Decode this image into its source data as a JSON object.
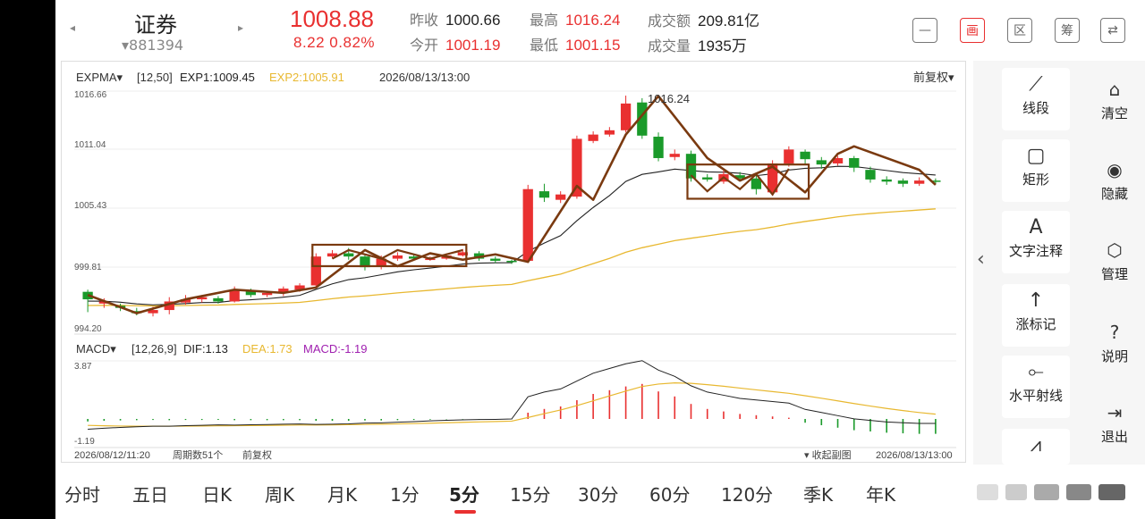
{
  "quote": {
    "nav_prev": "◂",
    "nav_next": "▸",
    "name": "证券",
    "code": "▾881394",
    "price": "1008.88",
    "change": "8.22  0.82%",
    "prev_close_label": "昨收",
    "prev_close": "1000.66",
    "open_label": "今开",
    "open": "1001.19",
    "high_label": "最高",
    "high": "1016.24",
    "low_label": "最低",
    "low": "1001.15",
    "amount_label": "成交额",
    "amount": "209.81亿",
    "volume_label": "成交量",
    "volume": "1935万"
  },
  "toolbar_buttons": [
    "—",
    "画",
    "区",
    "筹",
    "⇄"
  ],
  "chart": {
    "indicator": "EXPMA▾",
    "params": "[12,50]",
    "exp1": "EXP1:1009.45",
    "exp2": "EXP2:1005.91",
    "timestamp": "2026/08/13/13:00",
    "adjust": "前复权▾",
    "yticks": [
      "1016.66",
      "1011.04",
      "1005.43",
      "999.81",
      "994.20"
    ],
    "high_note": "1016.24",
    "macd_label": "MACD▾",
    "macd_params": "[12,26,9]",
    "dif": "DIF:1.13",
    "dea": "DEA:1.73",
    "macd": "MACD:-1.19",
    "macd_top": "3.87",
    "macd_bottom": "-1.19",
    "footer_start": "2026/08/12/11:20",
    "footer_count": "周期数51个",
    "footer_adjust": "前复权",
    "footer_collapse": "▾ 收起副图",
    "footer_end": "2026/08/13/13:00",
    "colors": {
      "up": "#e93030",
      "down": "#1a9a2a",
      "exp1": "#222222",
      "exp2": "#e8b830",
      "drawing": "#7a3a10"
    }
  },
  "tools": [
    "线段",
    "矩形",
    "文字注释",
    "涨标记",
    "水平射线"
  ],
  "tool_icons": [
    "segment-icon",
    "rectangle-icon",
    "text-annotation-icon",
    "up-mark-icon",
    "horizontal-ray-icon"
  ],
  "side_actions": [
    "清空",
    "隐藏",
    "管理",
    "说明",
    "退出"
  ],
  "periods": [
    "分时",
    "五日",
    "日K",
    "周K",
    "月K",
    "1分",
    "5分",
    "15分",
    "30分",
    "60分",
    "120分",
    "季K",
    "年K"
  ],
  "active_period": "5分",
  "candles": [
    [
      997.9,
      997.2,
      998.1,
      996.0
    ],
    [
      996.8,
      997.0,
      997.3,
      996.4
    ],
    [
      996.6,
      996.4,
      996.8,
      996.1
    ],
    [
      996.1,
      995.9,
      996.4,
      995.7
    ],
    [
      995.9,
      996.2,
      996.5,
      995.6
    ],
    [
      996.2,
      997.0,
      997.4,
      995.8
    ],
    [
      996.9,
      997.2,
      997.6,
      996.7
    ],
    [
      997.2,
      997.4,
      997.6,
      996.9
    ],
    [
      997.3,
      997.0,
      997.5,
      996.8
    ],
    [
      997.0,
      998.0,
      998.4,
      996.9
    ],
    [
      998.0,
      997.6,
      998.2,
      997.4
    ],
    [
      997.6,
      997.8,
      998.0,
      997.4
    ],
    [
      997.8,
      998.2,
      998.4,
      997.5
    ],
    [
      998.1,
      998.5,
      998.7,
      997.9
    ],
    [
      998.5,
      1001.2,
      1001.5,
      998.3
    ],
    [
      1001.2,
      1001.5,
      1001.8,
      1001.0
    ],
    [
      1001.5,
      1001.2,
      1002.0,
      1000.9
    ],
    [
      1001.2,
      1000.2,
      1001.4,
      999.9
    ],
    [
      1000.3,
      1001.0,
      1001.3,
      1000.0
    ],
    [
      1001.0,
      1001.3,
      1001.6,
      1000.8
    ],
    [
      1001.2,
      1001.0,
      1001.4,
      1000.9
    ],
    [
      1000.9,
      1001.0,
      1001.2,
      1000.8
    ],
    [
      1001.0,
      1001.3,
      1001.5,
      1000.9
    ],
    [
      1001.3,
      1001.6,
      1001.9,
      1001.2
    ],
    [
      1001.5,
      1001.0,
      1001.7,
      1000.8
    ],
    [
      1001.0,
      1000.8,
      1001.2,
      1000.6
    ],
    [
      1000.8,
      1000.7,
      1000.9,
      1000.5
    ],
    [
      1000.8,
      1007.5,
      1007.9,
      1000.6
    ],
    [
      1007.3,
      1006.7,
      1008.0,
      1006.3
    ],
    [
      1006.5,
      1007.0,
      1007.3,
      1006.2
    ],
    [
      1006.8,
      1012.2,
      1012.5,
      1006.6
    ],
    [
      1012.0,
      1012.6,
      1012.9,
      1011.8
    ],
    [
      1012.6,
      1013.0,
      1013.3,
      1012.4
    ],
    [
      1013.0,
      1015.5,
      1016.24,
      1012.8
    ],
    [
      1015.6,
      1012.5,
      1016.0,
      1012.2
    ],
    [
      1012.4,
      1010.4,
      1012.8,
      1010.1
    ],
    [
      1010.5,
      1010.8,
      1011.2,
      1010.2
    ],
    [
      1010.8,
      1008.5,
      1011.1,
      1008.2
    ],
    [
      1008.6,
      1008.4,
      1008.9,
      1008.2
    ],
    [
      1008.2,
      1008.9,
      1009.3,
      1008.0
    ],
    [
      1008.8,
      1008.5,
      1009.1,
      1008.2
    ],
    [
      1008.5,
      1007.5,
      1008.8,
      1007.0
    ],
    [
      1007.2,
      1009.9,
      1010.2,
      1006.9
    ],
    [
      1009.9,
      1011.2,
      1011.5,
      1009.6
    ],
    [
      1011.0,
      1010.3,
      1011.2,
      1009.8
    ],
    [
      1010.2,
      1009.8,
      1010.5,
      1009.4
    ],
    [
      1009.9,
      1010.4,
      1010.6,
      1009.7
    ],
    [
      1010.4,
      1009.5,
      1010.6,
      1009.1
    ],
    [
      1009.3,
      1008.4,
      1009.6,
      1008.1
    ],
    [
      1008.4,
      1008.2,
      1008.7,
      1007.9
    ],
    [
      1008.3,
      1008.0,
      1008.5,
      1007.7
    ],
    [
      1008.0,
      1008.3,
      1008.6,
      1007.8
    ],
    [
      1008.3,
      1008.2,
      1008.5,
      1008.0
    ]
  ],
  "macd_bars": [
    -0.2,
    -0.15,
    -0.12,
    -0.1,
    -0.08,
    -0.1,
    -0.08,
    -0.08,
    -0.07,
    -0.1,
    -0.1,
    -0.1,
    -0.1,
    -0.1,
    -0.15,
    -0.15,
    -0.15,
    -0.12,
    -0.12,
    -0.1,
    -0.08,
    -0.05,
    -0.03,
    -0.02,
    -0.02,
    -0.03,
    -0.02,
    0.5,
    0.8,
    1.0,
    1.5,
    2.0,
    2.3,
    2.6,
    2.8,
    2.2,
    1.8,
    1.2,
    0.8,
    0.6,
    0.4,
    0.3,
    0.2,
    0.1,
    -0.3,
    -0.5,
    -0.7,
    -0.9,
    -1.0,
    -1.1,
    -1.15,
    -1.19,
    -1.19
  ]
}
